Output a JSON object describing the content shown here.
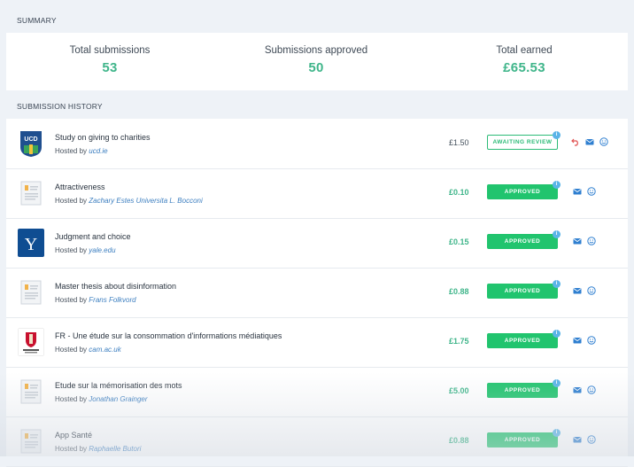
{
  "summary": {
    "label": "SUMMARY",
    "stats": [
      {
        "label": "Total submissions",
        "value": "53"
      },
      {
        "label": "Submissions approved",
        "value": "50"
      },
      {
        "label": "Total earned",
        "value": "£65.53"
      }
    ]
  },
  "history": {
    "label": "SUBMISSION HISTORY",
    "hosted_by_prefix": "Hosted by",
    "rows": [
      {
        "title": "Study on giving to charities",
        "host": "ucd.ie",
        "reward": "£1.50",
        "status": "AWAITING REVIEW",
        "thumb": "ucd-logo-icon"
      },
      {
        "title": "Attractiveness",
        "host": "Zachary Estes Universita L. Bocconi",
        "reward": "£0.10",
        "status": "APPROVED",
        "thumb": "document-placeholder-icon"
      },
      {
        "title": "Judgment and choice",
        "host": "yale.edu",
        "reward": "£0.15",
        "status": "APPROVED",
        "thumb": "yale-logo-icon"
      },
      {
        "title": "Master thesis about disinformation",
        "host": "Frans Folkvord",
        "reward": "£0.88",
        "status": "APPROVED",
        "thumb": "document-placeholder-icon"
      },
      {
        "title": "FR - Une étude sur la consommation d'informations médiatiques",
        "host": "cam.ac.uk",
        "reward": "£1.75",
        "status": "APPROVED",
        "thumb": "cambridge-logo-icon"
      },
      {
        "title": "Etude sur la mémorisation des mots",
        "host": "Jonathan Grainger",
        "reward": "£5.00",
        "status": "APPROVED",
        "thumb": "document-placeholder-icon"
      },
      {
        "title": "App Santé",
        "host": "Raphaelle Butori",
        "reward": "£0.88",
        "status": "APPROVED",
        "thumb": "document-placeholder-icon"
      }
    ]
  },
  "icons": {
    "info": "i",
    "undo": "undo-icon",
    "message": "envelope-icon",
    "smiley": "smiley-icon"
  },
  "colors": {
    "accent_green": "#3fb58a",
    "approved_bg": "#21c46e",
    "link_blue": "#3d7fc0",
    "info_blue": "#5bb4e8",
    "undo_red": "#e05252",
    "background": "#eef2f7"
  }
}
